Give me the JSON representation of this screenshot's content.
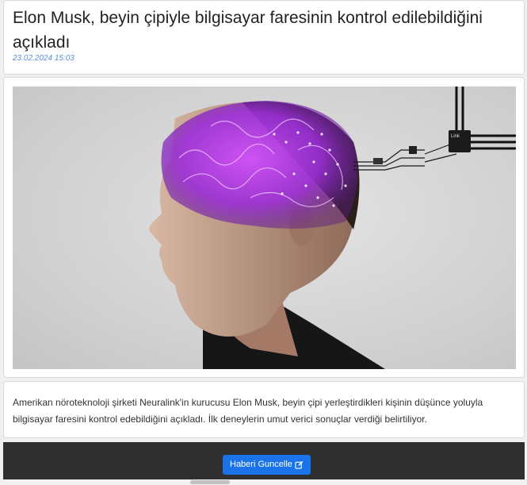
{
  "article": {
    "title": "Elon Musk, beyin çipiyle bilgisayar faresinin kontrol edilebildiğini açıkladı",
    "date": "23.02.2024 15:03",
    "summary": "Amerikan nöroteknoloji şirketi Neuralink'in kurucusu Elon Musk, beyin çipi yerleştirdikleri kişinin düşünce yoluyla bilgisayar faresini kontrol edebildiğini açıkladı. İlk deneylerin umut verici sonuçlar verdiği belirtiliyor."
  },
  "image": {
    "chip_label": "Link"
  },
  "footer": {
    "update_button_label": "Haberi Guncelle",
    "update_icon": "edit-icon"
  },
  "colors": {
    "accent": "#1a73e8",
    "date": "#5b8fd6",
    "footer_bg": "#2f2f2f"
  }
}
